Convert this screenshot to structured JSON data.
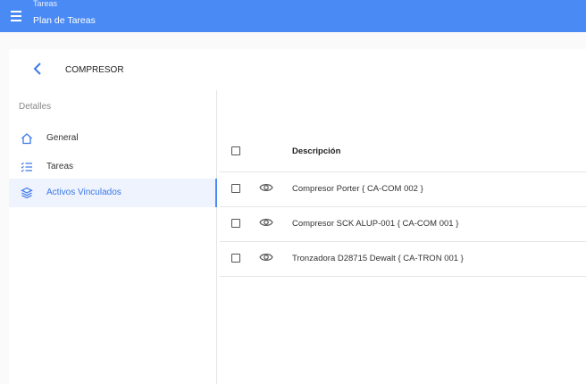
{
  "topbar": {
    "breadcrumb": "Tareas",
    "title": "Plan de Tareas"
  },
  "header": {
    "asset_name": "COMPRESOR"
  },
  "sidebar": {
    "section_label": "Detalles",
    "items": [
      {
        "label": "General",
        "icon": "home-icon"
      },
      {
        "label": "Tareas",
        "icon": "checklist-icon"
      },
      {
        "label": "Activos Vinculados",
        "icon": "layers-icon",
        "active": true
      }
    ]
  },
  "table": {
    "columns": [
      "Descripción"
    ],
    "rows": [
      {
        "description": "Compresor Porter { CA-COM 002 }"
      },
      {
        "description": "Compresor SCK ALUP-001 { CA-COM 001 }"
      },
      {
        "description": "Tronzadora D28715 Dewalt { CA-TRON 001 }"
      }
    ]
  },
  "colors": {
    "primary": "#4a8af4",
    "active_bg": "#eef3fd",
    "active_text": "#3b78e7"
  }
}
